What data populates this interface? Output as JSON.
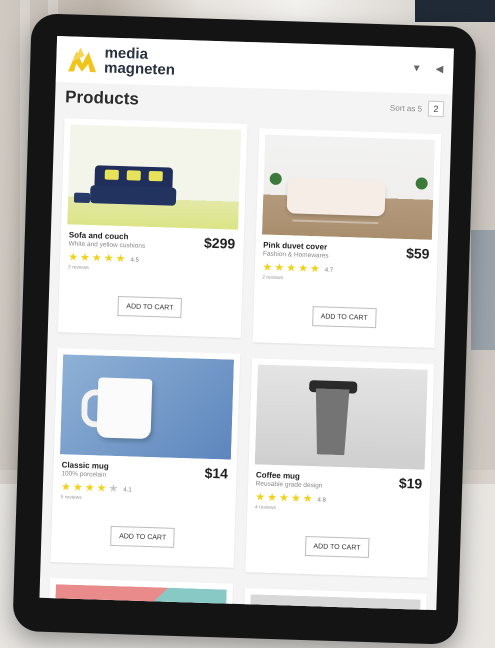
{
  "brand": {
    "name_line1": "media",
    "name_line2": "magneten",
    "logo_color": "#f0c419"
  },
  "top_icons": [
    "chevron-down-icon",
    "back-arrow-icon"
  ],
  "page": {
    "title": "Products",
    "pager_text": "Sort as 5",
    "pager_button": "2"
  },
  "products": [
    {
      "name": "Sofa and couch",
      "desc": "White and yellow cushions",
      "price": "$299",
      "rating": 4.5,
      "rating_text": "4.5",
      "rating_count": "3 reviews",
      "cart": "ADD TO CART"
    },
    {
      "name": "Pink duvet cover",
      "desc": "Fashion & Homewares",
      "price": "$59",
      "rating": 4.7,
      "rating_text": "4.7",
      "rating_count": "2 reviews",
      "cart": "ADD TO CART"
    },
    {
      "name": "Classic mug",
      "desc": "100% porcelain",
      "price": "$14",
      "rating": 4.1,
      "rating_text": "4.1",
      "rating_count": "5 reviews",
      "cart": "ADD TO CART"
    },
    {
      "name": "Coffee mug",
      "desc": "Reusable grade design",
      "price": "$19",
      "rating": 4.8,
      "rating_text": "4.8",
      "rating_count": "4 reviews",
      "cart": "ADD TO CART"
    }
  ],
  "colors": {
    "star": "#f0d21b",
    "brand_text": "#2a3240"
  }
}
